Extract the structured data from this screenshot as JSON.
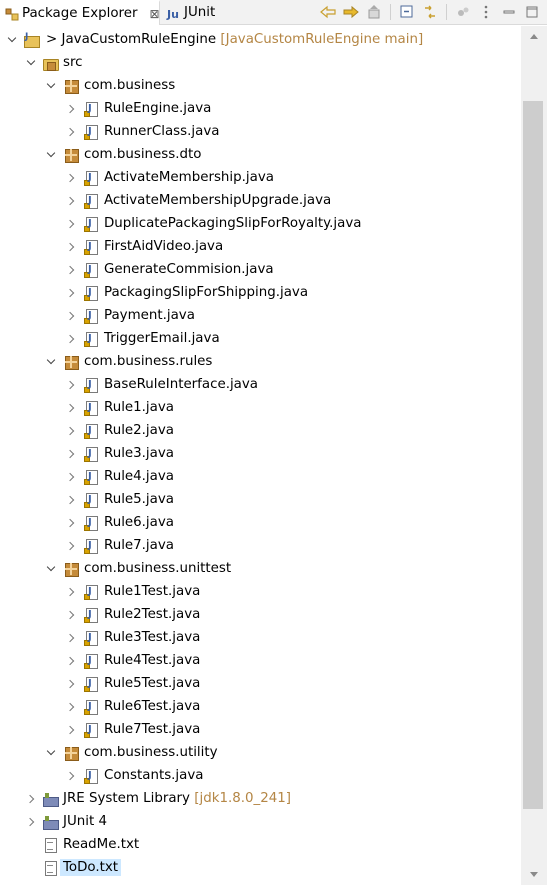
{
  "tabs": {
    "package_explorer": "Package Explorer",
    "close": "⊠",
    "junit": "JUnit"
  },
  "tree": {
    "project": {
      "name": "JavaCustomRuleEngine",
      "decoration": "[JavaCustomRuleEngine main]",
      "prefix": ">"
    },
    "src": "src",
    "packages": [
      {
        "name": "com.business",
        "files": [
          "RuleEngine.java",
          "RunnerClass.java"
        ]
      },
      {
        "name": "com.business.dto",
        "files": [
          "ActivateMembership.java",
          "ActivateMembershipUpgrade.java",
          "DuplicatePackagingSlipForRoyalty.java",
          "FirstAidVideo.java",
          "GenerateCommision.java",
          "PackagingSlipForShipping.java",
          "Payment.java",
          "TriggerEmail.java"
        ]
      },
      {
        "name": "com.business.rules",
        "files": [
          "BaseRuleInterface.java",
          "Rule1.java",
          "Rule2.java",
          "Rule3.java",
          "Rule4.java",
          "Rule5.java",
          "Rule6.java",
          "Rule7.java"
        ]
      },
      {
        "name": "com.business.unittest",
        "files": [
          "Rule1Test.java",
          "Rule2Test.java",
          "Rule3Test.java",
          "Rule4Test.java",
          "Rule5Test.java",
          "Rule6Test.java",
          "Rule7Test.java"
        ]
      },
      {
        "name": "com.business.utility",
        "files": [
          "Constants.java"
        ]
      }
    ],
    "jre": {
      "name": "JRE System Library",
      "decoration": "[jdk1.8.0_241]"
    },
    "junit": "JUnit 4",
    "readme": "ReadMe.txt",
    "todo": "ToDo.txt"
  },
  "colors": {
    "selection": "#cde8ff",
    "decoration": "#b48645"
  }
}
